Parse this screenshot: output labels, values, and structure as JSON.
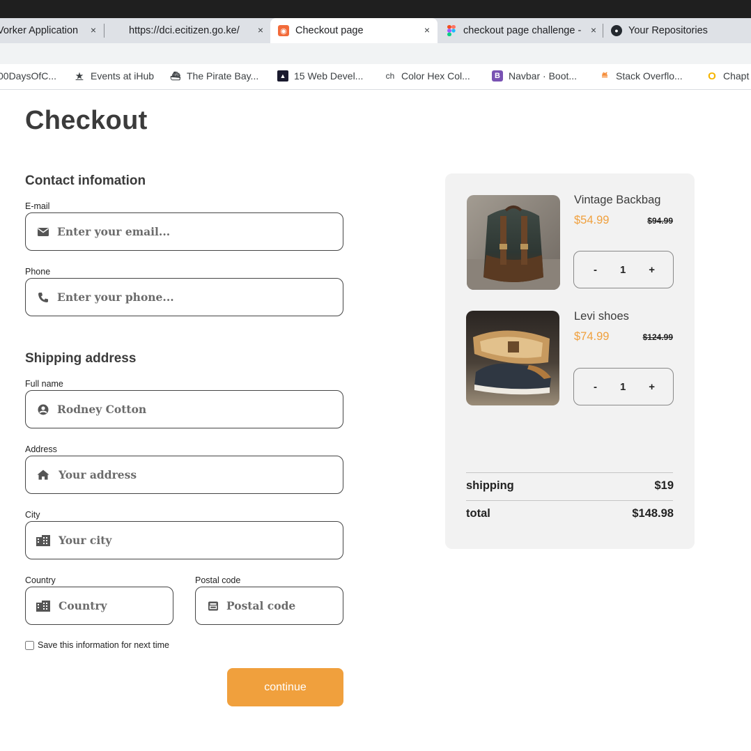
{
  "tabs": [
    {
      "title": "Vorker Application",
      "favicon": "none"
    },
    {
      "title": "https://dci.ecitizen.go.ke/",
      "favicon": "none"
    },
    {
      "title": "Checkout page",
      "favicon": "orange-square-icon",
      "active": true
    },
    {
      "title": "checkout page challenge -",
      "favicon": "figma-icon"
    },
    {
      "title": "Your Repositories",
      "favicon": "github-icon"
    }
  ],
  "tab_close_glyph": "×",
  "bookmarks": [
    {
      "label": "00DaysOfC...",
      "icon": "none"
    },
    {
      "label": "Events at iHub",
      "icon": "star-icon"
    },
    {
      "label": "The Pirate Bay...",
      "icon": "ship-icon"
    },
    {
      "label": "15 Web Devel...",
      "icon": "dev-icon"
    },
    {
      "label": "Color Hex Col...",
      "icon": "ch-icon",
      "glyph": "ch"
    },
    {
      "label": "Navbar · Boot...",
      "icon": "bootstrap-icon",
      "glyph": "B"
    },
    {
      "label": "Stack Overflo...",
      "icon": "stackoverflow-icon"
    },
    {
      "label": "Chapt",
      "icon": "opera-icon"
    }
  ],
  "page": {
    "title": "Checkout",
    "contact_title": "Contact infomation",
    "shipping_title": "Shipping address",
    "email": {
      "label": "E-mail",
      "placeholder": "Enter your email..."
    },
    "phone": {
      "label": "Phone",
      "placeholder": "Enter your phone..."
    },
    "full_name": {
      "label": "Full name",
      "placeholder": "Rodney Cotton"
    },
    "address": {
      "label": "Address",
      "placeholder": "Your address"
    },
    "city": {
      "label": "City",
      "placeholder": "Your city"
    },
    "country": {
      "label": "Country",
      "placeholder": "Country"
    },
    "postal": {
      "label": "Postal code",
      "placeholder": "Postal code"
    },
    "save_label": "Save this information for next time",
    "continue_label": "continue"
  },
  "cart": {
    "items": [
      {
        "name": "Vintage Backbag",
        "price": "$54.99",
        "old_price": "$94.99",
        "qty": "1"
      },
      {
        "name": "Levi shoes",
        "price": "$74.99",
        "old_price": "$124.99",
        "qty": "1"
      }
    ],
    "minus": "-",
    "plus": "+",
    "shipping_label": "shipping",
    "shipping_value": "$19",
    "total_label": "total",
    "total_value": "$148.98"
  },
  "colors": {
    "accent": "#f0a03d",
    "card_bg": "#f2f2f2",
    "title": "#3b3b3b"
  }
}
